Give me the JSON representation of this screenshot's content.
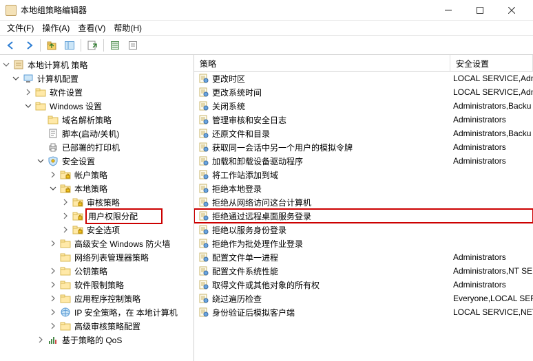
{
  "window": {
    "title": "本地组策略编辑器"
  },
  "menu": {
    "file": "文件(F)",
    "action": "操作(A)",
    "view": "查看(V)",
    "help": "帮助(H)"
  },
  "tree": {
    "root": "本地计算机 策略",
    "nodes": [
      {
        "depth": 0,
        "exp": "open",
        "icon": "computer",
        "label": "计算机配置"
      },
      {
        "depth": 1,
        "exp": "closed",
        "icon": "folder",
        "label": "软件设置"
      },
      {
        "depth": 1,
        "exp": "open",
        "icon": "folder",
        "label": "Windows 设置"
      },
      {
        "depth": 2,
        "exp": "none",
        "icon": "folder",
        "label": "域名解析策略"
      },
      {
        "depth": 2,
        "exp": "none",
        "icon": "script",
        "label": "脚本(启动/关机)"
      },
      {
        "depth": 2,
        "exp": "none",
        "icon": "printer",
        "label": "已部署的打印机"
      },
      {
        "depth": 2,
        "exp": "open",
        "icon": "security",
        "label": "安全设置"
      },
      {
        "depth": 3,
        "exp": "closed",
        "icon": "folderlock",
        "label": "帐户策略"
      },
      {
        "depth": 3,
        "exp": "open",
        "icon": "folderlock",
        "label": "本地策略"
      },
      {
        "depth": 4,
        "exp": "closed",
        "icon": "folderlock",
        "label": "审核策略"
      },
      {
        "depth": 4,
        "exp": "closed",
        "icon": "folderlock",
        "label": "用户权限分配",
        "highlight": true
      },
      {
        "depth": 4,
        "exp": "closed",
        "icon": "folderlock",
        "label": "安全选项"
      },
      {
        "depth": 3,
        "exp": "closed",
        "icon": "folder",
        "label": "高级安全 Windows 防火墙"
      },
      {
        "depth": 3,
        "exp": "none",
        "icon": "folder",
        "label": "网络列表管理器策略"
      },
      {
        "depth": 3,
        "exp": "closed",
        "icon": "folder",
        "label": "公钥策略"
      },
      {
        "depth": 3,
        "exp": "closed",
        "icon": "folder",
        "label": "软件限制策略"
      },
      {
        "depth": 3,
        "exp": "closed",
        "icon": "folder",
        "label": "应用程序控制策略"
      },
      {
        "depth": 3,
        "exp": "closed",
        "icon": "ipsec",
        "label": "IP 安全策略，在 本地计算机"
      },
      {
        "depth": 3,
        "exp": "closed",
        "icon": "folder",
        "label": "高级审核策略配置"
      },
      {
        "depth": 2,
        "exp": "closed",
        "icon": "qos",
        "label": "基于策略的 QoS"
      }
    ]
  },
  "list_header": {
    "policy": "策略",
    "setting": "安全设置"
  },
  "policies": [
    {
      "name": "更改时区",
      "setting": "LOCAL SERVICE,Adm"
    },
    {
      "name": "更改系统时间",
      "setting": "LOCAL SERVICE,Adm"
    },
    {
      "name": "关闭系统",
      "setting": "Administrators,Backu"
    },
    {
      "name": "管理审核和安全日志",
      "setting": "Administrators"
    },
    {
      "name": "还原文件和目录",
      "setting": "Administrators,Backu"
    },
    {
      "name": "获取同一会话中另一个用户的模拟令牌",
      "setting": "Administrators"
    },
    {
      "name": "加载和卸载设备驱动程序",
      "setting": "Administrators"
    },
    {
      "name": "将工作站添加到域",
      "setting": ""
    },
    {
      "name": "拒绝本地登录",
      "setting": ""
    },
    {
      "name": "拒绝从网络访问这台计算机",
      "setting": ""
    },
    {
      "name": "拒绝通过远程桌面服务登录",
      "setting": "",
      "highlight": true
    },
    {
      "name": "拒绝以服务身份登录",
      "setting": ""
    },
    {
      "name": "拒绝作为批处理作业登录",
      "setting": ""
    },
    {
      "name": "配置文件单一进程",
      "setting": "Administrators"
    },
    {
      "name": "配置文件系统性能",
      "setting": "Administrators,NT SE"
    },
    {
      "name": "取得文件或其他对象的所有权",
      "setting": "Administrators"
    },
    {
      "name": "绕过遍历检查",
      "setting": "Everyone,LOCAL SERV"
    },
    {
      "name": "身份验证后模拟客户端",
      "setting": "LOCAL SERVICE,NET."
    }
  ]
}
